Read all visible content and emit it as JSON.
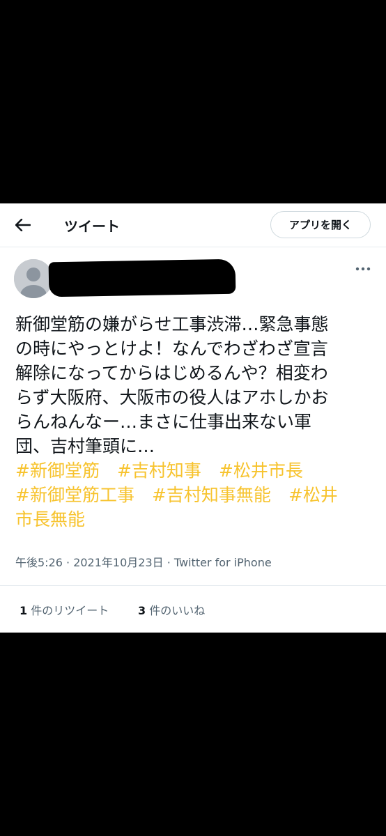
{
  "header": {
    "title": "ツイート",
    "open_app_label": "アプリを開く"
  },
  "tweet": {
    "lines": [
      "新御堂筋の嫌がらせ工事渋滞…緊急事態",
      "の時にやっとけよ！なんでわざわざ宣言",
      "解除になってからはじめるんや？相変わ",
      "らず大阪府、大阪市の役人はアホしかお",
      "らんねんなー…まさに仕事出来ない軍",
      "団、吉村筆頭に…"
    ],
    "hashtags": {
      "tag1": "#新御堂筋",
      "tag2": "#吉村知事",
      "tag3": "#松井市長",
      "tag4": "#新御堂筋工事",
      "tag5": "#吉村知事無能",
      "tag6_part1": "#松井",
      "tag6_part2": "市長無能"
    },
    "timestamp": "午後5:26 · 2021年10月23日 · Twitter for iPhone"
  },
  "stats": {
    "retweets_count": "1",
    "retweets_label": " 件のリツイート",
    "likes_count": "3",
    "likes_label": " 件のいいね"
  },
  "colors": {
    "hashtag": "#f7c32e",
    "text": "#0f1419",
    "secondary": "#536471",
    "background": "#000000"
  },
  "icons": {
    "back": "back-arrow-icon",
    "more": "more-dots-icon",
    "avatar": "default-avatar-icon"
  }
}
